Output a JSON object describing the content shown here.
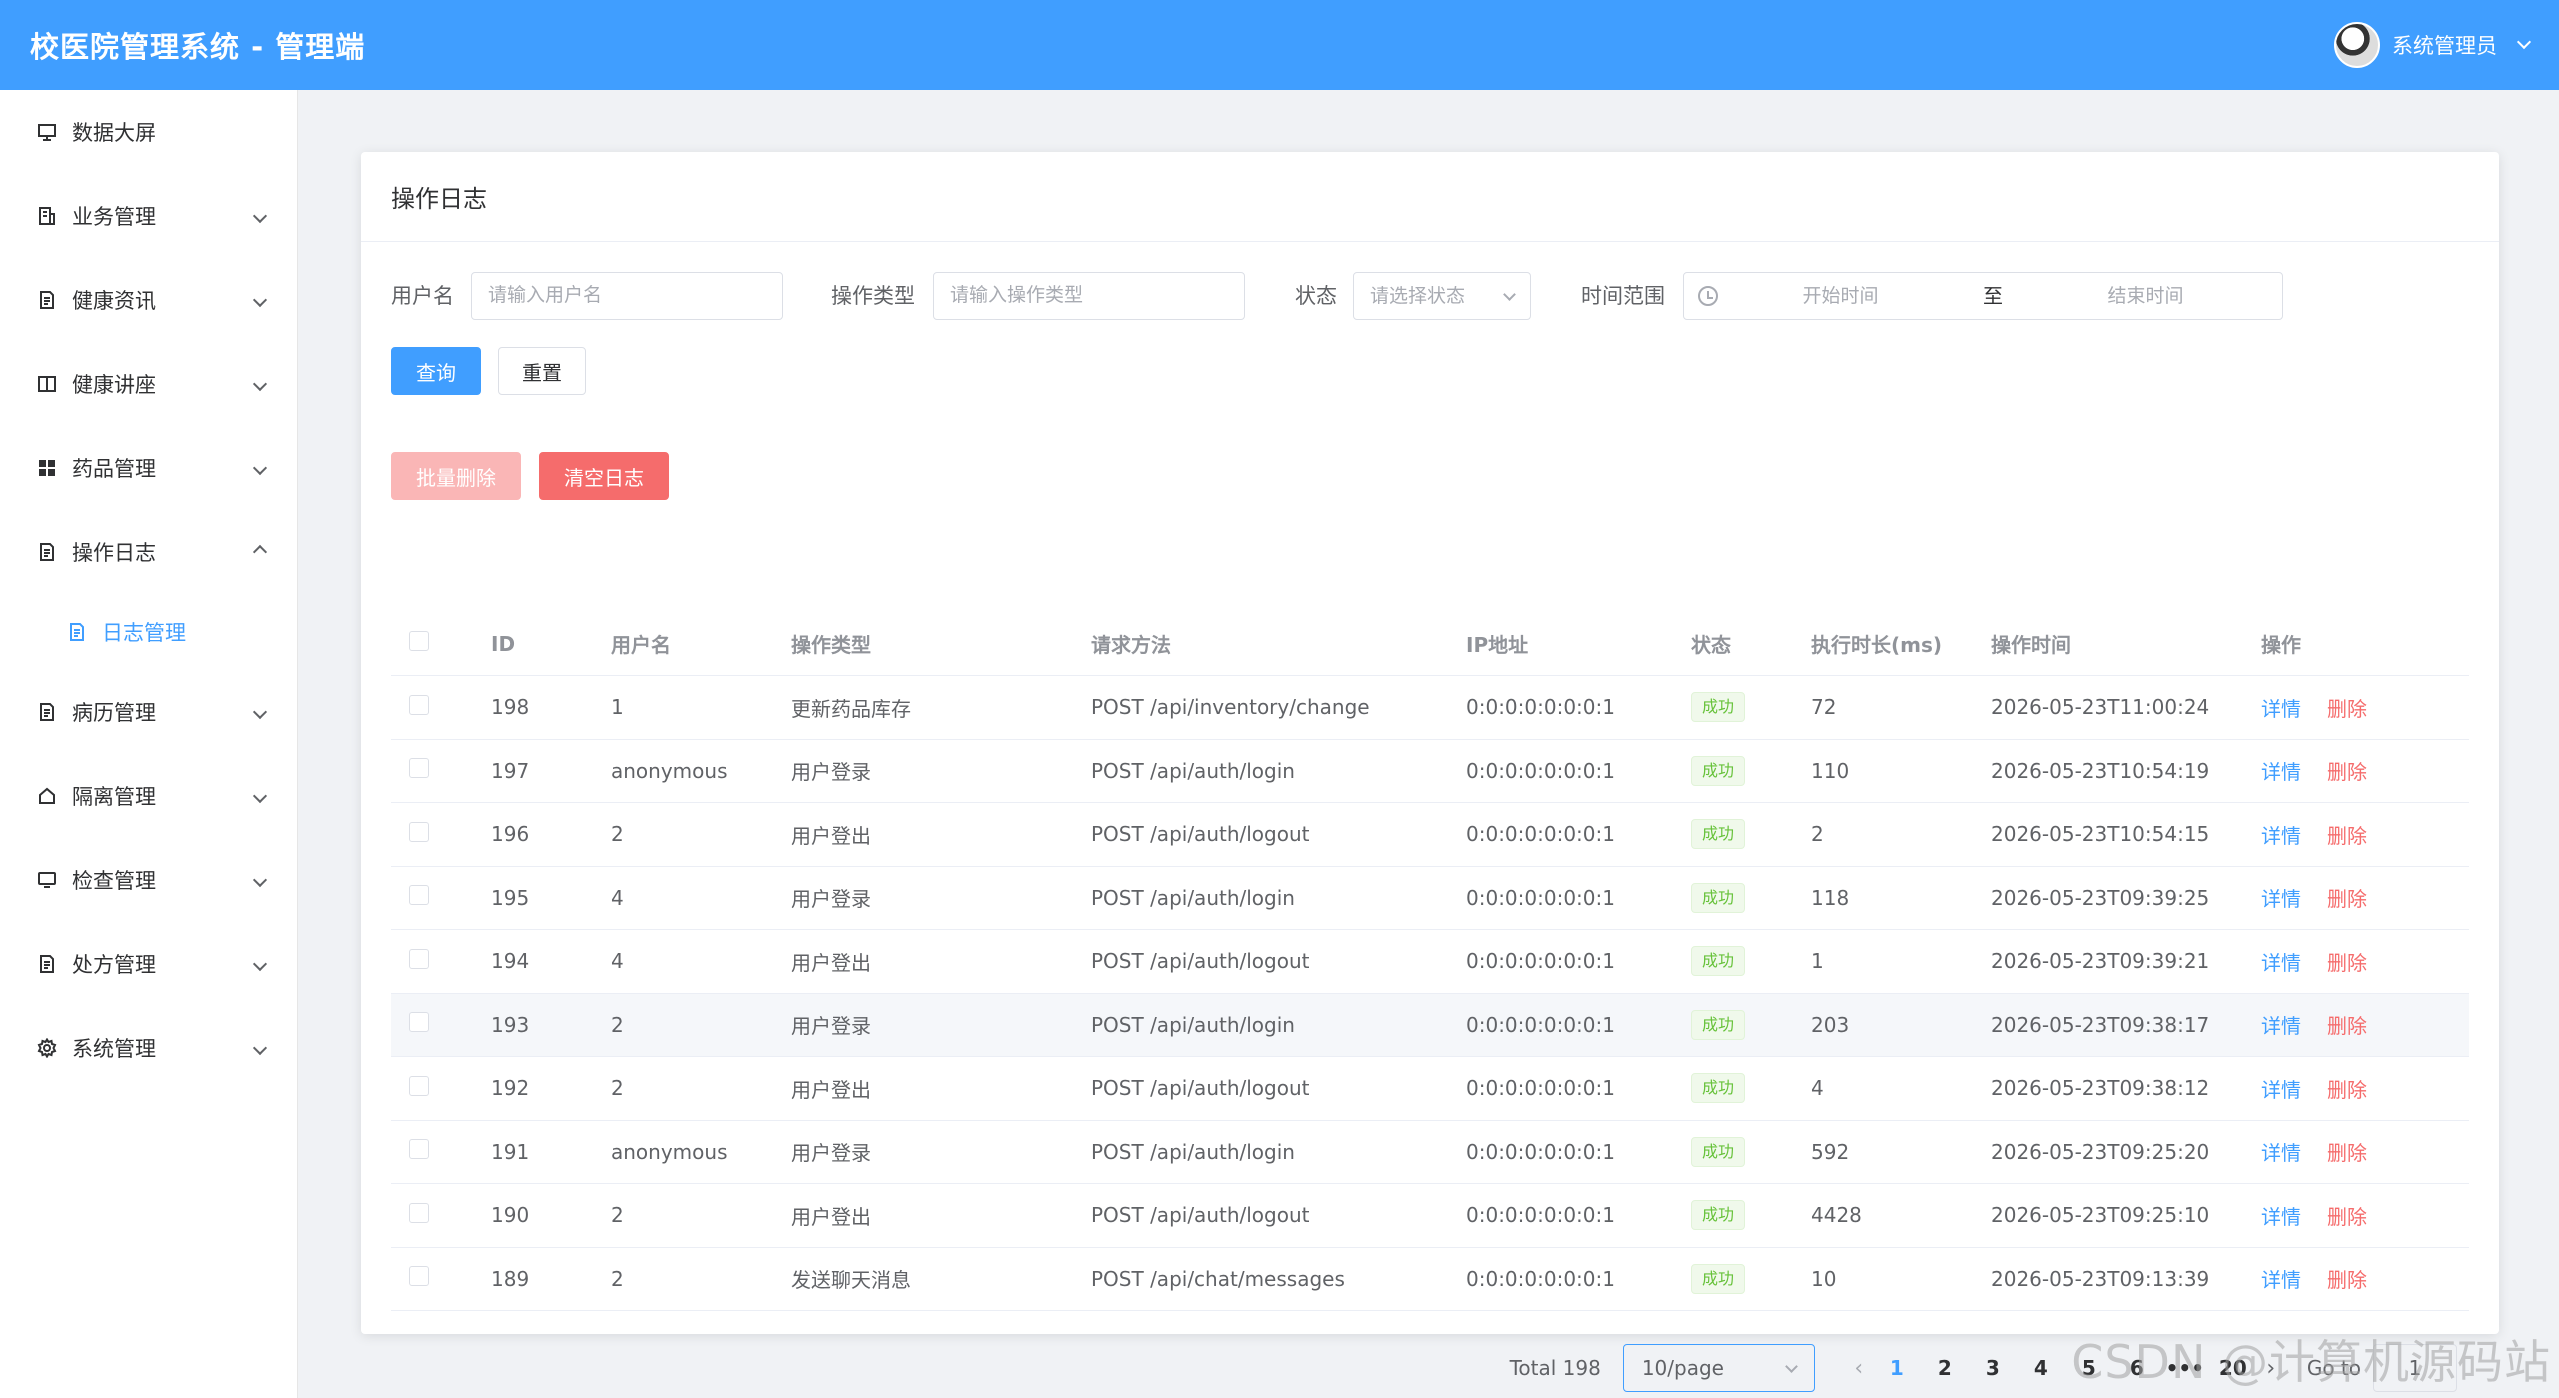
{
  "header": {
    "title": "校医院管理系统 - 管理端",
    "user_name": "系统管理员"
  },
  "sidebar": {
    "items": [
      {
        "label": "数据大屏",
        "icon": "screen-icon"
      },
      {
        "label": "业务管理",
        "icon": "building-icon"
      },
      {
        "label": "健康资讯",
        "icon": "document-icon"
      },
      {
        "label": "健康讲座",
        "icon": "book-icon"
      },
      {
        "label": "药品管理",
        "icon": "grid-icon"
      },
      {
        "label": "操作日志",
        "icon": "document-icon",
        "expanded": true
      },
      {
        "label": "病历管理",
        "icon": "document-icon"
      },
      {
        "label": "隔离管理",
        "icon": "house-icon"
      },
      {
        "label": "检查管理",
        "icon": "monitor-icon"
      },
      {
        "label": "处方管理",
        "icon": "document-icon"
      },
      {
        "label": "系统管理",
        "icon": "gear-icon"
      }
    ],
    "sub_item": {
      "label": "日志管理",
      "icon": "document-icon"
    }
  },
  "card": {
    "title": "操作日志"
  },
  "filters": {
    "username_label": "用户名",
    "username_placeholder": "请输入用户名",
    "optype_label": "操作类型",
    "optype_placeholder": "请输入操作类型",
    "status_label": "状态",
    "status_placeholder": "请选择状态",
    "range_label": "时间范围",
    "range_start": "开始时间",
    "range_sep": "至",
    "range_end": "结束时间",
    "search_button": "查询",
    "reset_button": "重置"
  },
  "actions": {
    "batch_delete": "批量删除",
    "clear_logs": "清空日志"
  },
  "table": {
    "columns": [
      "ID",
      "用户名",
      "操作类型",
      "请求方法",
      "IP地址",
      "状态",
      "执行时长(ms)",
      "操作时间",
      "操作"
    ],
    "detail_label": "详情",
    "delete_label": "删除",
    "rows": [
      {
        "id": "198",
        "user": "1",
        "type": "更新药品库存",
        "method": "POST /api/inventory/change",
        "ip": "0:0:0:0:0:0:0:1",
        "status": "成功",
        "duration": "72",
        "time": "2026-05-23T11:00:24"
      },
      {
        "id": "197",
        "user": "anonymous",
        "type": "用户登录",
        "method": "POST /api/auth/login",
        "ip": "0:0:0:0:0:0:0:1",
        "status": "成功",
        "duration": "110",
        "time": "2026-05-23T10:54:19"
      },
      {
        "id": "196",
        "user": "2",
        "type": "用户登出",
        "method": "POST /api/auth/logout",
        "ip": "0:0:0:0:0:0:0:1",
        "status": "成功",
        "duration": "2",
        "time": "2026-05-23T10:54:15"
      },
      {
        "id": "195",
        "user": "4",
        "type": "用户登录",
        "method": "POST /api/auth/login",
        "ip": "0:0:0:0:0:0:0:1",
        "status": "成功",
        "duration": "118",
        "time": "2026-05-23T09:39:25"
      },
      {
        "id": "194",
        "user": "4",
        "type": "用户登出",
        "method": "POST /api/auth/logout",
        "ip": "0:0:0:0:0:0:0:1",
        "status": "成功",
        "duration": "1",
        "time": "2026-05-23T09:39:21"
      },
      {
        "id": "193",
        "user": "2",
        "type": "用户登录",
        "method": "POST /api/auth/login",
        "ip": "0:0:0:0:0:0:0:1",
        "status": "成功",
        "duration": "203",
        "time": "2026-05-23T09:38:17"
      },
      {
        "id": "192",
        "user": "2",
        "type": "用户登出",
        "method": "POST /api/auth/logout",
        "ip": "0:0:0:0:0:0:0:1",
        "status": "成功",
        "duration": "4",
        "time": "2026-05-23T09:38:12"
      },
      {
        "id": "191",
        "user": "anonymous",
        "type": "用户登录",
        "method": "POST /api/auth/login",
        "ip": "0:0:0:0:0:0:0:1",
        "status": "成功",
        "duration": "592",
        "time": "2026-05-23T09:25:20"
      },
      {
        "id": "190",
        "user": "2",
        "type": "用户登出",
        "method": "POST /api/auth/logout",
        "ip": "0:0:0:0:0:0:0:1",
        "status": "成功",
        "duration": "4428",
        "time": "2026-05-23T09:25:10"
      },
      {
        "id": "189",
        "user": "2",
        "type": "发送聊天消息",
        "method": "POST /api/chat/messages",
        "ip": "0:0:0:0:0:0:0:1",
        "status": "成功",
        "duration": "10",
        "time": "2026-05-23T09:13:39"
      }
    ]
  },
  "pagination": {
    "total_text": "Total 198",
    "page_size": "10/page",
    "pages": [
      "1",
      "2",
      "3",
      "4",
      "5",
      "6",
      "•••",
      "20"
    ],
    "current": "1",
    "goto_label": "Go to",
    "goto_value": "1"
  },
  "watermark": "CSDN @计算机源码站",
  "colors": {
    "primary": "#409eff",
    "danger": "#f56c6c",
    "success": "#67c23a"
  }
}
